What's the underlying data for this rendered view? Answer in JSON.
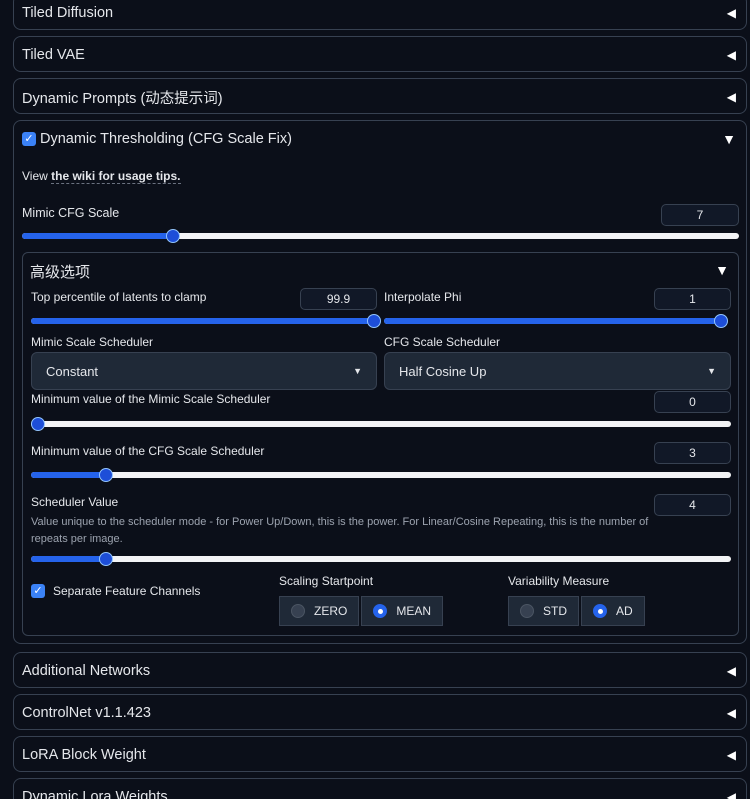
{
  "accordions_top": [
    {
      "title": "Tiled Diffusion"
    },
    {
      "title": "Tiled VAE"
    },
    {
      "title": "Dynamic Prompts (动态提示词)"
    }
  ],
  "dt": {
    "title": "Dynamic Thresholding (CFG Scale Fix)",
    "enabled": true,
    "wiki_prefix": "View ",
    "wiki_link": "the wiki for usage tips.",
    "mimic_label": "Mimic CFG Scale",
    "mimic_value": "7",
    "mimic_fraction": 0.21,
    "advanced": {
      "title": "高级选项",
      "top_percentile_label": "Top percentile of latents to clamp",
      "top_percentile_value": "99.9",
      "top_percentile_fraction": 0.999,
      "interp_phi_label": "Interpolate Phi",
      "interp_phi_value": "1",
      "interp_phi_fraction": 1.0,
      "mimic_sched_label": "Mimic Scale Scheduler",
      "mimic_sched_value": "Constant",
      "cfg_sched_label": "CFG Scale Scheduler",
      "cfg_sched_value": "Half Cosine Up",
      "min_mimic_label": "Minimum value of the Mimic Scale Scheduler",
      "min_mimic_value": "0",
      "min_mimic_fraction": 0.0,
      "min_cfg_label": "Minimum value of the CFG Scale Scheduler",
      "min_cfg_value": "3",
      "min_cfg_fraction": 0.107,
      "sched_value_label": "Scheduler Value",
      "sched_value_value": "4",
      "sched_value_fraction": 0.107,
      "sched_value_desc": "Value unique to the scheduler mode - for Power Up/Down, this is the power. For Linear/Cosine Repeating, this is the number of repeats per image.",
      "separate_channels_label": "Separate Feature Channels",
      "separate_channels_checked": true,
      "scaling_startpoint_label": "Scaling Startpoint",
      "scaling_options": [
        "ZERO",
        "MEAN"
      ],
      "scaling_selected": "MEAN",
      "variability_label": "Variability Measure",
      "variability_options": [
        "STD",
        "AD"
      ],
      "variability_selected": "AD"
    }
  },
  "accordions_bottom": [
    {
      "title": "Additional Networks"
    },
    {
      "title": "ControlNet v1.1.423"
    },
    {
      "title": "LoRA Block Weight"
    },
    {
      "title": "Dynamic Lora Weights"
    }
  ],
  "icons": {
    "collapsed": "◀",
    "expanded": "▼",
    "caret": "▼",
    "check": "✓"
  },
  "colors": {
    "background": "#0b0f19",
    "accent": "#2563eb",
    "border": "#374151"
  }
}
